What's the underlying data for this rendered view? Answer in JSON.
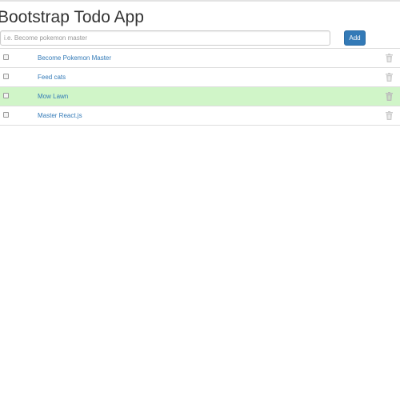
{
  "app": {
    "title": "Bootstrap Todo App"
  },
  "new_todo": {
    "placeholder": "i.e. Become pokemon master",
    "value": "",
    "add_label": "Add"
  },
  "todos": [
    {
      "label": "Become Pokemon Master",
      "completed": false
    },
    {
      "label": "Feed cats",
      "completed": false
    },
    {
      "label": "Mow Lawn",
      "completed": true
    },
    {
      "label": "Master React.js",
      "completed": false
    }
  ],
  "icons": {
    "delete": "trash-icon"
  },
  "colors": {
    "accent": "#337ab7",
    "completed_row": "#d0f5c8",
    "icon_gray": "#cccccc"
  }
}
